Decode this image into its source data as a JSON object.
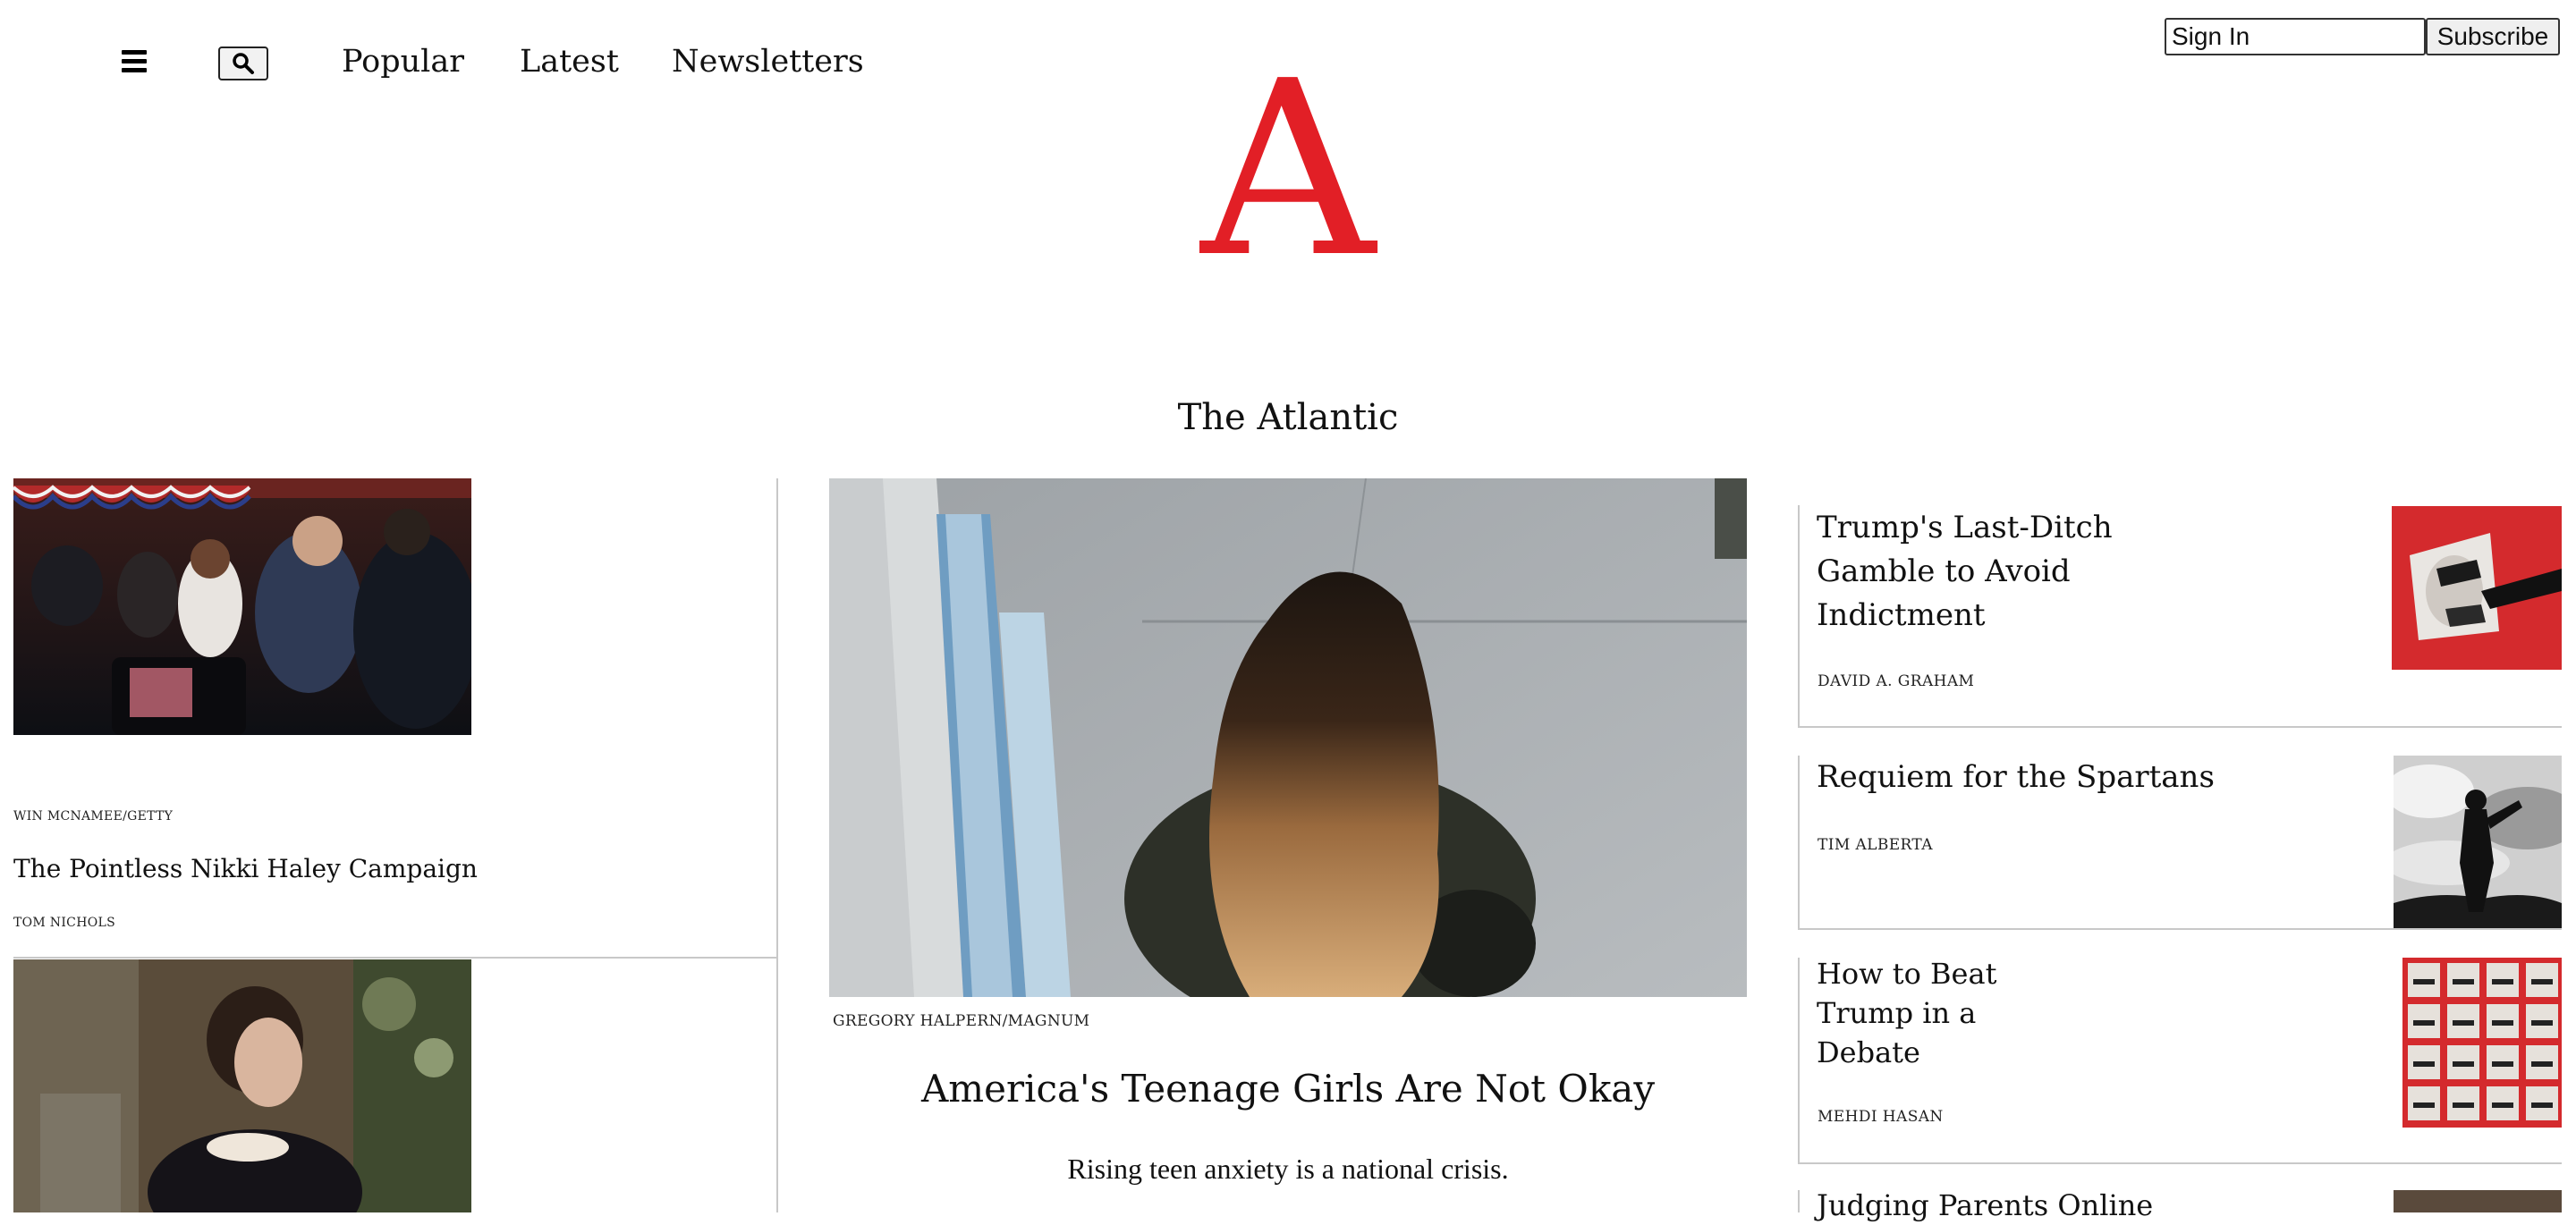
{
  "header": {
    "nav": [
      {
        "label": "Popular"
      },
      {
        "label": "Latest"
      },
      {
        "label": "Newsletters"
      }
    ],
    "signin_label": "Sign In",
    "subscribe_label": "Subscribe",
    "logo_letter": "A",
    "masthead": "The Atlantic"
  },
  "left": {
    "story1": {
      "credit": "WIN MCNAMEE/GETTY",
      "title": "The Pointless Nikki Haley Campaign",
      "author": "TOM NICHOLS"
    }
  },
  "center": {
    "credit": "GREGORY HALPERN/MAGNUM",
    "title": "America's Teenage Girls Are Not Okay",
    "dek": "Rising teen anxiety is a national crisis."
  },
  "right": {
    "stories": [
      {
        "title_lines": [
          "Trump's Last-Ditch",
          "Gamble to Avoid",
          "Indictment"
        ],
        "author": "DAVID A. GRAHAM"
      },
      {
        "title_lines": [
          "Requiem for the Spartans"
        ],
        "author": "TIM ALBERTA"
      },
      {
        "title_lines": [
          "How to Beat",
          "Trump in a",
          "Debate"
        ],
        "author": "MEHDI HASAN"
      },
      {
        "title_lines": [
          "Judging Parents Online"
        ],
        "author": ""
      }
    ]
  },
  "colors": {
    "brand_red": "#e21f26",
    "rule": "#c8c8c8"
  },
  "icons": [
    "menu-icon",
    "search-icon"
  ]
}
